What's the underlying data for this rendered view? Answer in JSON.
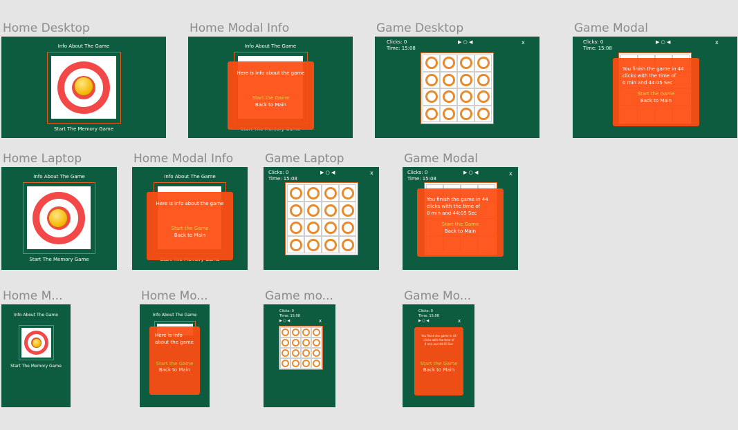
{
  "frames": {
    "home_desktop": "Home Desktop",
    "home_modal_info_1": "Home Modal Info",
    "game_desktop": "Game Desktop",
    "game_modal_1": "Game Modal",
    "home_laptop": "Home Laptop",
    "home_modal_info_2": "Home Modal Info",
    "game_laptop": "Game Laptop",
    "game_modal_2": "Game Modal",
    "home_mobile": "Home M...",
    "home_modal_mobile": "Home Mo...",
    "game_mobile": "Game mo...",
    "game_modal_mobile": "Game Mo..."
  },
  "home": {
    "info_link": "Info About The Game",
    "start_link": "Start The Memory Game"
  },
  "modal_info": {
    "text": "Here is info about the game",
    "text_line1": "Here is info",
    "text_line2": "about the game",
    "start": "Start the Game",
    "back": "Back to Main"
  },
  "game": {
    "clicks": "Clicks: 0",
    "time": "Time: 15:08",
    "controls": "▶ ○ ◀",
    "close": "x"
  },
  "game_modal": {
    "line1": "You finish the game in 44",
    "line2": "clicks with the time of",
    "line3": "0 min and 44:05 Sec",
    "start": "Start the Game",
    "back": "Back to Main"
  },
  "icons": [
    "target-icon",
    "smiley-thumbs-up-icon",
    "play-icon",
    "pause-icon",
    "rewind-icon",
    "close-icon"
  ],
  "colors": {
    "canvas": "#e5e5e5",
    "frame": "#0d5c3f",
    "accent": "#ff4d12",
    "ring": "#e88a2e",
    "target": "#f34848"
  }
}
